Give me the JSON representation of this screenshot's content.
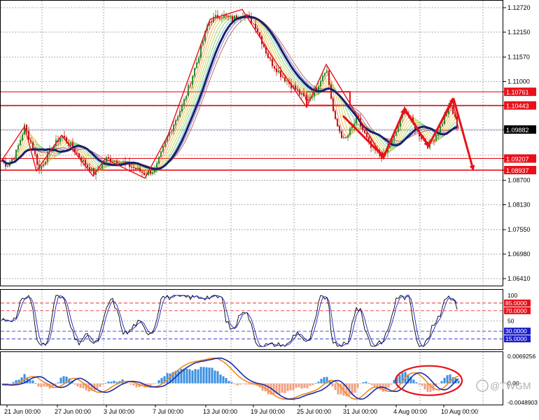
{
  "colors": {
    "background": "#ffffff",
    "plot_bg": "#ffffff",
    "grid": "#9a9a9a",
    "frame": "#000000",
    "candle_up": "#2a8f2a",
    "candle_down": "#c01818",
    "level_line": "#e8111a",
    "ma_main": "#1a1e6e",
    "price_tag_red": "#e8111a",
    "price_tag_black": "#000000",
    "stoch_main": "#000000",
    "stoch_signal": "#1a1ec8",
    "stoch_level_red": "#e8111a",
    "stoch_level_blue": "#1a1ec8",
    "macd_up": "#3a8fe0",
    "macd_down": "#f0a080",
    "macd_line": "#1a2aa8",
    "macd_signal": "#f08a1a"
  },
  "chart_data": [
    {
      "type": "candlestick",
      "panel": "price",
      "ylim": [
        1.06,
        1.13
      ],
      "y_ticks": [
        "1.12720",
        "1.12150",
        "1.11570",
        "1.11000",
        "1.10761",
        "1.10443",
        "1.09882",
        "1.09207",
        "1.08937",
        "1.08700",
        "1.08130",
        "1.07550",
        "1.06980",
        "1.06410"
      ],
      "red_tags": [
        "1.10761",
        "1.10443",
        "1.09207",
        "1.08937"
      ],
      "current_price_tag": "1.09882",
      "horizontal_levels": [
        1.10761,
        1.10443,
        1.09207,
        1.08937
      ],
      "current_price": 1.09882,
      "x_ticks": [
        "21 Jun 00:00",
        "27 Jun 00:00",
        "3 Jul 00:00",
        "7 Jul 00:00",
        "13 Jul 00:00",
        "19 Jul 00:00",
        "25 Jul 00:00",
        "31 Jul 00:00",
        "4 Aug 00:00",
        "10 Aug 00:00"
      ],
      "price_path": [
        [
          0,
          1.092
        ],
        [
          10,
          1.0905
        ],
        [
          22,
          1.093
        ],
        [
          35,
          1.0995
        ],
        [
          46,
          1.095
        ],
        [
          56,
          1.0895
        ],
        [
          70,
          1.0935
        ],
        [
          88,
          1.0975
        ],
        [
          104,
          1.0945
        ],
        [
          118,
          1.0915
        ],
        [
          135,
          1.0885
        ],
        [
          152,
          1.092
        ],
        [
          170,
          1.0915
        ],
        [
          190,
          1.09
        ],
        [
          207,
          1.0885
        ],
        [
          222,
          1.0895
        ],
        [
          240,
          1.0975
        ],
        [
          262,
          1.105
        ],
        [
          282,
          1.115
        ],
        [
          298,
          1.124
        ],
        [
          315,
          1.1255
        ],
        [
          332,
          1.1245
        ],
        [
          346,
          1.1262
        ],
        [
          365,
          1.123
        ],
        [
          385,
          1.115
        ],
        [
          402,
          1.1115
        ],
        [
          420,
          1.1085
        ],
        [
          438,
          1.1055
        ],
        [
          452,
          1.1085
        ],
        [
          466,
          1.1135
        ],
        [
          478,
          1.101
        ],
        [
          492,
          1.096
        ],
        [
          510,
          1.1015
        ],
        [
          530,
          1.0945
        ],
        [
          548,
          1.0925
        ],
        [
          563,
          1.097
        ],
        [
          578,
          1.1035
        ],
        [
          593,
          1.099
        ],
        [
          612,
          1.095
        ],
        [
          628,
          1.099
        ],
        [
          643,
          1.1045
        ],
        [
          655,
          1.099
        ]
      ],
      "zigzag": [
        [
          0,
          1.091
        ],
        [
          35,
          1.0995
        ],
        [
          52,
          1.0892
        ],
        [
          88,
          1.0975
        ],
        [
          133,
          1.088
        ],
        [
          150,
          1.092
        ],
        [
          207,
          1.0875
        ],
        [
          240,
          1.0975
        ],
        [
          300,
          1.1245
        ],
        [
          346,
          1.1268
        ],
        [
          392,
          1.115
        ],
        [
          438,
          1.104
        ],
        [
          466,
          1.114
        ],
        [
          548,
          1.092
        ],
        [
          578,
          1.104
        ],
        [
          612,
          1.095
        ],
        [
          646,
          1.106
        ],
        [
          655,
          1.099
        ]
      ],
      "projection_arrows": [
        [
          [
            490,
            1.102
          ],
          [
            548,
            1.0925
          ]
        ],
        [
          [
            548,
            1.0925
          ],
          [
            578,
            1.1035
          ]
        ],
        [
          [
            578,
            1.1035
          ],
          [
            612,
            1.095
          ]
        ],
        [
          [
            612,
            1.095
          ],
          [
            648,
            1.106
          ]
        ],
        [
          [
            648,
            1.106
          ],
          [
            676,
            1.0895
          ]
        ]
      ],
      "consolidation_box": {
        "from_x": 438,
        "to_x": 500,
        "top": 1.10761,
        "bottom": 1.10443
      }
    },
    {
      "type": "line",
      "panel": "stochastic",
      "ylim": [
        0,
        100
      ],
      "y_ticks": [
        "100",
        "85.0000",
        "70.0000",
        "50",
        "30.0000",
        "15.0000"
      ],
      "levels": [
        85,
        70,
        50,
        30,
        15
      ]
    },
    {
      "type": "histogram",
      "panel": "macd",
      "y_ticks": [
        "0.0069256",
        "0.00",
        "-0.0048903"
      ],
      "range": [
        -0.0048903,
        0.0069256
      ],
      "highlight_ellipse": {
        "x_from": 565,
        "x_to": 660
      }
    }
  ],
  "watermark": "@TWGM"
}
